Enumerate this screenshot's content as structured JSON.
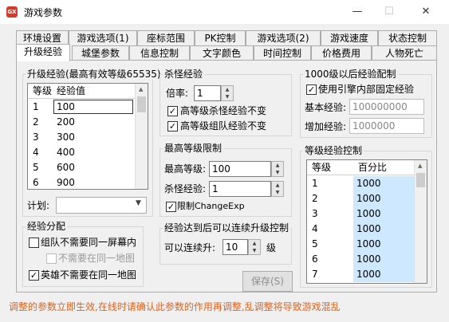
{
  "window": {
    "title": "游戏参数",
    "icon_label": "GX",
    "minimize": "—",
    "maximize": "☐",
    "close": "✕"
  },
  "tabs_row1": [
    "环境设置",
    "游戏选项(1)",
    "座标范围",
    "PK控制",
    "游戏选项(2)",
    "游戏速度",
    "状态控制"
  ],
  "tabs_row2": [
    "升级经验",
    "城堡参数",
    "信息控制",
    "文字颜色",
    "时间控制",
    "价格费用",
    "人物死亡"
  ],
  "active_tab": "升级经验",
  "upgrade_exp": {
    "group_label": "升级经验(最高有效等级65535)",
    "col_level": "等级",
    "col_value": "经验值",
    "rows": [
      [
        "1",
        "100"
      ],
      [
        "2",
        "200"
      ],
      [
        "3",
        "300"
      ],
      [
        "4",
        "400"
      ],
      [
        "5",
        "600"
      ],
      [
        "6",
        "900"
      ]
    ],
    "plan_label": "计划:",
    "plan_value": ""
  },
  "exp_split": {
    "group_label": "经验分配",
    "opt1": {
      "label": "组队不需要同一屏幕内",
      "checked": ""
    },
    "opt2": {
      "label": "不需要在同一地图",
      "checked": ""
    },
    "opt3": {
      "label": "英雄不需要在同一地图",
      "checked": "✓"
    }
  },
  "kill_exp": {
    "group_label": "杀怪经验",
    "rate_label": "倍率:",
    "rate_value": "1",
    "opt1": {
      "label": "高等级杀怪经验不变",
      "checked": "✓"
    },
    "opt2": {
      "label": "高等级组队经验不变",
      "checked": "✓"
    }
  },
  "max_level": {
    "group_label": "最高等级限制",
    "level_label": "最高等级:",
    "level_value": "100",
    "kill_label": "杀怪经验:",
    "kill_value": "1",
    "limit": {
      "label": "限制ChangeExp",
      "checked": "✓"
    }
  },
  "continuous": {
    "group_label": "经验达到后可以连续升级控制",
    "label": "可以连续升:",
    "value": "10",
    "unit": "级"
  },
  "save_button": "保存(S)",
  "fixed_exp": {
    "group_label": "1000级以后经验配制",
    "use": {
      "label": "使用引擎内部固定经验",
      "checked": "✓"
    },
    "base_label": "基本经验:",
    "base_value": "100000000",
    "inc_label": "增加经验:",
    "inc_value": "1000000"
  },
  "level_ctrl": {
    "group_label": "等级经验控制",
    "col_level": "等级",
    "col_pct": "百分比",
    "rows": [
      [
        "1",
        "1000"
      ],
      [
        "2",
        "1000"
      ],
      [
        "3",
        "1000"
      ],
      [
        "4",
        "1000"
      ],
      [
        "5",
        "1000"
      ],
      [
        "6",
        "1000"
      ],
      [
        "7",
        "1000"
      ]
    ]
  },
  "status_text": "调整的参数立即生效,在线时请确认此参数的作用再调整,乱调整将导致游戏混乱"
}
